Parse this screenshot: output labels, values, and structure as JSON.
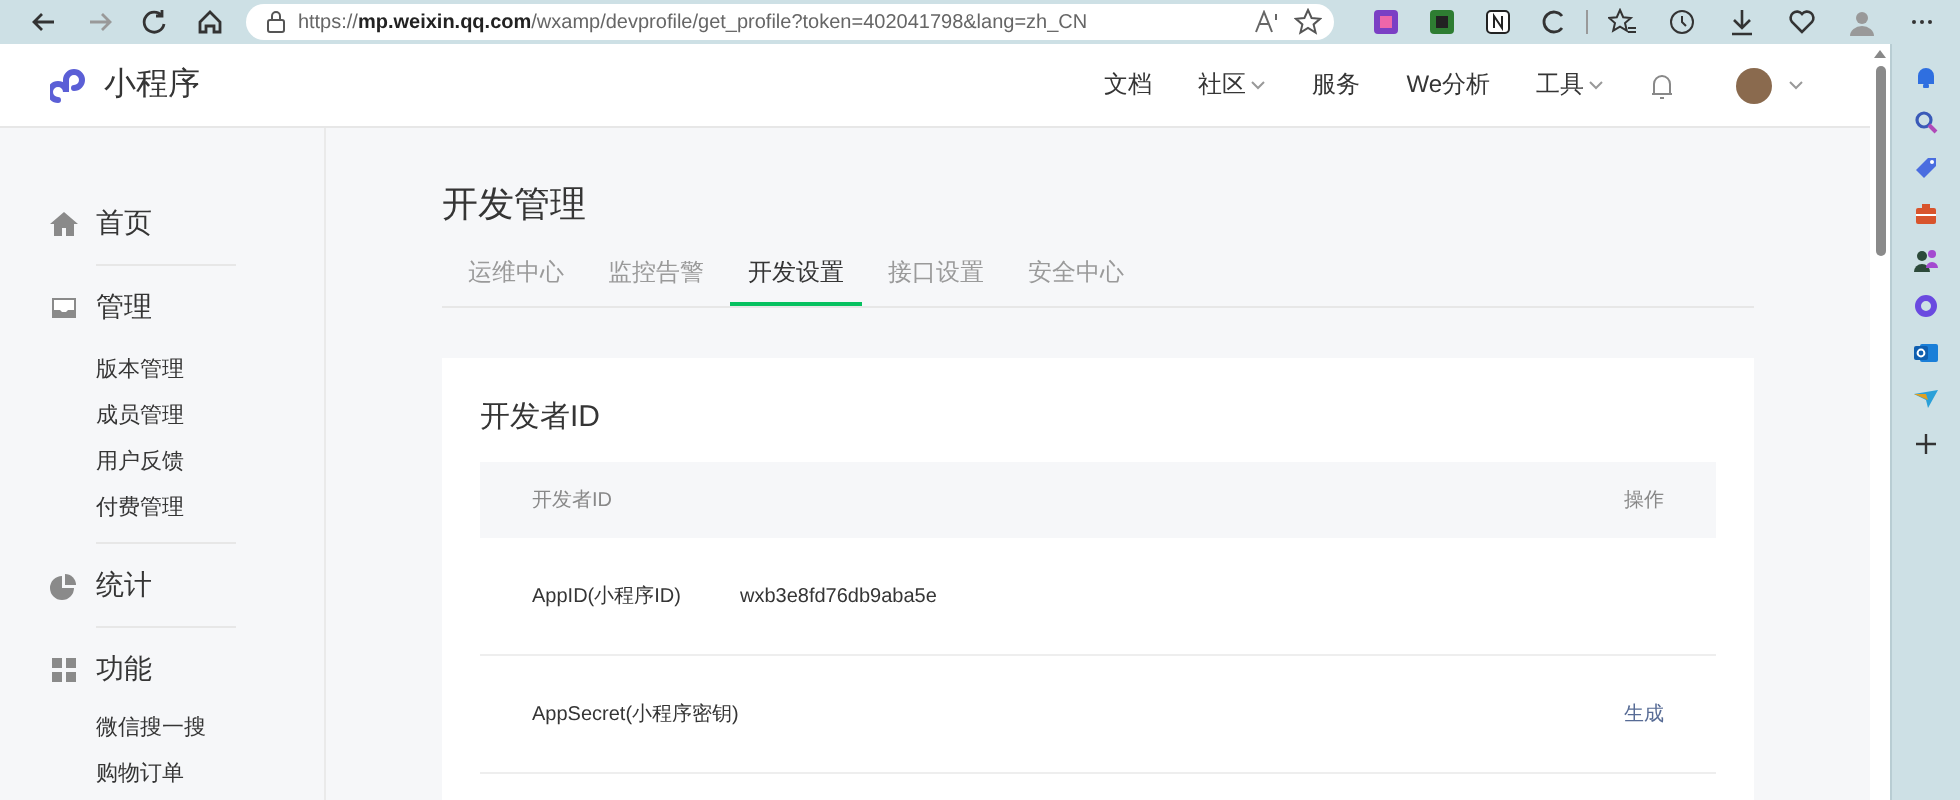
{
  "browser": {
    "address": "https://**mp.weixin.qq.com**/wxamp/devprofile/get_profile?token=402041798&lang=zh_CN"
  },
  "header": {
    "logo": "小程序",
    "nav": [
      {
        "label": "文档",
        "dropdown": false
      },
      {
        "label": "社区",
        "dropdown": true
      },
      {
        "label": "服务",
        "dropdown": false
      },
      {
        "label": "We分析",
        "dropdown": false
      },
      {
        "label": "工具",
        "dropdown": true
      }
    ]
  },
  "sidebar": {
    "sections": [
      {
        "label": "首页"
      },
      {
        "label": "管理",
        "children": [
          "版本管理",
          "成员管理",
          "用户反馈",
          "付费管理"
        ]
      },
      {
        "label": "统计"
      },
      {
        "label": "功能",
        "children": [
          "微信搜一搜",
          "购物订单"
        ]
      }
    ]
  },
  "page": {
    "title": "开发管理",
    "tabs": [
      {
        "label": "运维中心",
        "selected": false
      },
      {
        "label": "监控告警",
        "selected": false
      },
      {
        "label": "开发设置",
        "selected": true
      },
      {
        "label": "接口设置",
        "selected": false
      },
      {
        "label": "安全中心",
        "selected": false
      }
    ],
    "card": {
      "title": "开发者ID",
      "columns": [
        "开发者ID",
        "操作"
      ],
      "rows": [
        {
          "label": "AppID(小程序ID)",
          "value": "wxb3e8fd76db9aba5e"
        },
        {
          "label": "AppSecret(小程序密钥)",
          "action": "生成"
        }
      ]
    }
  }
}
